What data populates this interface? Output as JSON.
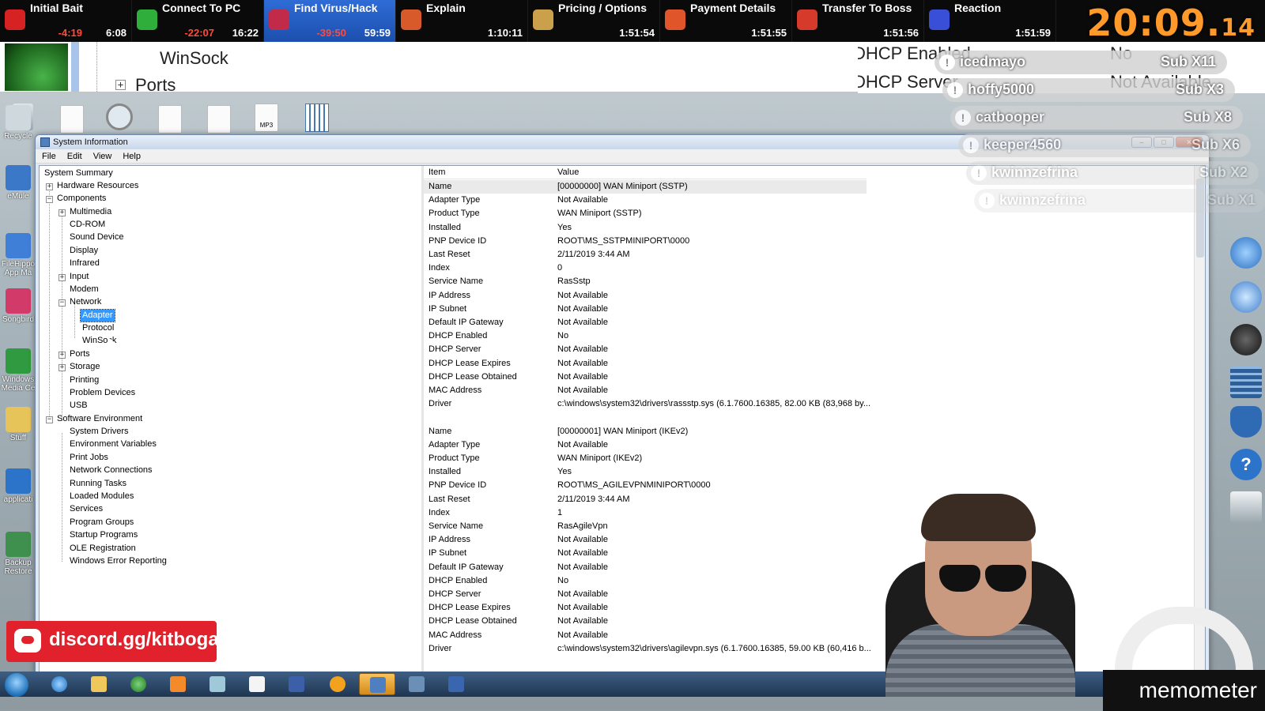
{
  "splits": [
    {
      "name": "Initial Bait",
      "delta": "-4:19",
      "time": "6:08",
      "color": "#d62222"
    },
    {
      "name": "Connect To PC",
      "delta": "-22:07",
      "time": "16:22",
      "color": "#2fae3c"
    },
    {
      "name": "Find Virus/Hack",
      "delta": "-39:50",
      "time": "59:59",
      "color": "#c22a4a"
    },
    {
      "name": "Explain",
      "delta": "",
      "time": "1:10:11",
      "color": "#d85a2a"
    },
    {
      "name": "Pricing / Options",
      "delta": "",
      "time": "1:51:54",
      "color": "#caa14a"
    },
    {
      "name": "Payment Details",
      "delta": "",
      "time": "1:51:55",
      "color": "#e0562a"
    },
    {
      "name": "Transfer To Boss",
      "delta": "",
      "time": "1:51:56",
      "color": "#d63a2a"
    },
    {
      "name": "Reaction",
      "delta": "",
      "time": "1:51:59",
      "color": "#3a4fd8"
    }
  ],
  "timer": {
    "main": "20:09.",
    "ms": "14"
  },
  "zoom": {
    "tree_winsock": "WinSock",
    "tree_ports": "Ports",
    "right_label_1": "DHCP Enabled",
    "right_value_1": "No",
    "right_label_2": "DHCP Server",
    "right_value_2": "Not Available"
  },
  "desktop": {
    "left_labels": [
      "Recycle",
      "eMule",
      "FileHippo App Ma",
      "Songbird",
      "Windows Media Ce",
      "Stuff",
      "applicati",
      "Backup Restore"
    ],
    "top_icon_mp3": "MP3"
  },
  "window": {
    "title": "System Information",
    "menu": [
      "File",
      "Edit",
      "View",
      "Help"
    ],
    "minimize": "–",
    "maximize": "□",
    "close": "✕"
  },
  "tree": {
    "root": "System Summary",
    "hardware": "Hardware Resources",
    "components": "Components",
    "multimedia": "Multimedia",
    "cdrom": "CD-ROM",
    "sound": "Sound Device",
    "display": "Display",
    "infrared": "Infrared",
    "input": "Input",
    "modem": "Modem",
    "network": "Network",
    "adapter": "Adapter",
    "protocol": "Protocol",
    "winsock": "WinSock",
    "ports": "Ports",
    "storage": "Storage",
    "printing": "Printing",
    "problem": "Problem Devices",
    "usb": "USB",
    "software": "Software Environment",
    "sw_children": [
      "System Drivers",
      "Environment Variables",
      "Print Jobs",
      "Network Connections",
      "Running Tasks",
      "Loaded Modules",
      "Services",
      "Program Groups",
      "Startup Programs",
      "OLE Registration",
      "Windows Error Reporting"
    ]
  },
  "detail": {
    "col_item": "Item",
    "col_value": "Value",
    "rows": [
      {
        "k": "Name",
        "v": "[00000000] WAN Miniport (SSTP)"
      },
      {
        "k": "Adapter Type",
        "v": "Not Available"
      },
      {
        "k": "Product Type",
        "v": "WAN Miniport (SSTP)"
      },
      {
        "k": "Installed",
        "v": "Yes"
      },
      {
        "k": "PNP Device ID",
        "v": "ROOT\\MS_SSTPMINIPORT\\0000"
      },
      {
        "k": "Last Reset",
        "v": "2/11/2019 3:44 AM"
      },
      {
        "k": "Index",
        "v": "0"
      },
      {
        "k": "Service Name",
        "v": "RasSstp"
      },
      {
        "k": "IP Address",
        "v": "Not Available"
      },
      {
        "k": "IP Subnet",
        "v": "Not Available"
      },
      {
        "k": "Default IP Gateway",
        "v": "Not Available"
      },
      {
        "k": "DHCP Enabled",
        "v": "No"
      },
      {
        "k": "DHCP Server",
        "v": "Not Available"
      },
      {
        "k": "DHCP Lease Expires",
        "v": "Not Available"
      },
      {
        "k": "DHCP Lease Obtained",
        "v": "Not Available"
      },
      {
        "k": "MAC Address",
        "v": "Not Available"
      },
      {
        "k": "Driver",
        "v": "c:\\windows\\system32\\drivers\\rassstp.sys (6.1.7600.16385, 82.00 KB (83,968 by..."
      },
      {
        "k": "",
        "v": ""
      },
      {
        "k": "Name",
        "v": "[00000001] WAN Miniport (IKEv2)"
      },
      {
        "k": "Adapter Type",
        "v": "Not Available"
      },
      {
        "k": "Product Type",
        "v": "WAN Miniport (IKEv2)"
      },
      {
        "k": "Installed",
        "v": "Yes"
      },
      {
        "k": "PNP Device ID",
        "v": "ROOT\\MS_AGILEVPNMINIPORT\\0000"
      },
      {
        "k": "Last Reset",
        "v": "2/11/2019 3:44 AM"
      },
      {
        "k": "Index",
        "v": "1"
      },
      {
        "k": "Service Name",
        "v": "RasAgileVpn"
      },
      {
        "k": "IP Address",
        "v": "Not Available"
      },
      {
        "k": "IP Subnet",
        "v": "Not Available"
      },
      {
        "k": "Default IP Gateway",
        "v": "Not Available"
      },
      {
        "k": "DHCP Enabled",
        "v": "No"
      },
      {
        "k": "DHCP Server",
        "v": "Not Available"
      },
      {
        "k": "DHCP Lease Expires",
        "v": "Not Available"
      },
      {
        "k": "DHCP Lease Obtained",
        "v": "Not Available"
      },
      {
        "k": "MAC Address",
        "v": "Not Available"
      },
      {
        "k": "Driver",
        "v": "c:\\windows\\system32\\drivers\\agilevpn.sys (6.1.7600.16385, 59.00 KB (60,416 b..."
      }
    ]
  },
  "chat": [
    {
      "name": "icedmayo",
      "sub": "Sub X11"
    },
    {
      "name": "hoffy5000",
      "sub": "Sub X3"
    },
    {
      "name": "catbooper",
      "sub": "Sub X8"
    },
    {
      "name": "keeper4560",
      "sub": "Sub X6"
    },
    {
      "name": "kwinnzefrina",
      "sub": "Sub X2"
    },
    {
      "name": "kwinnzefrina",
      "sub": "Sub X1"
    }
  ],
  "discord": "discord.gg/kitboga",
  "memometer": "memometer"
}
